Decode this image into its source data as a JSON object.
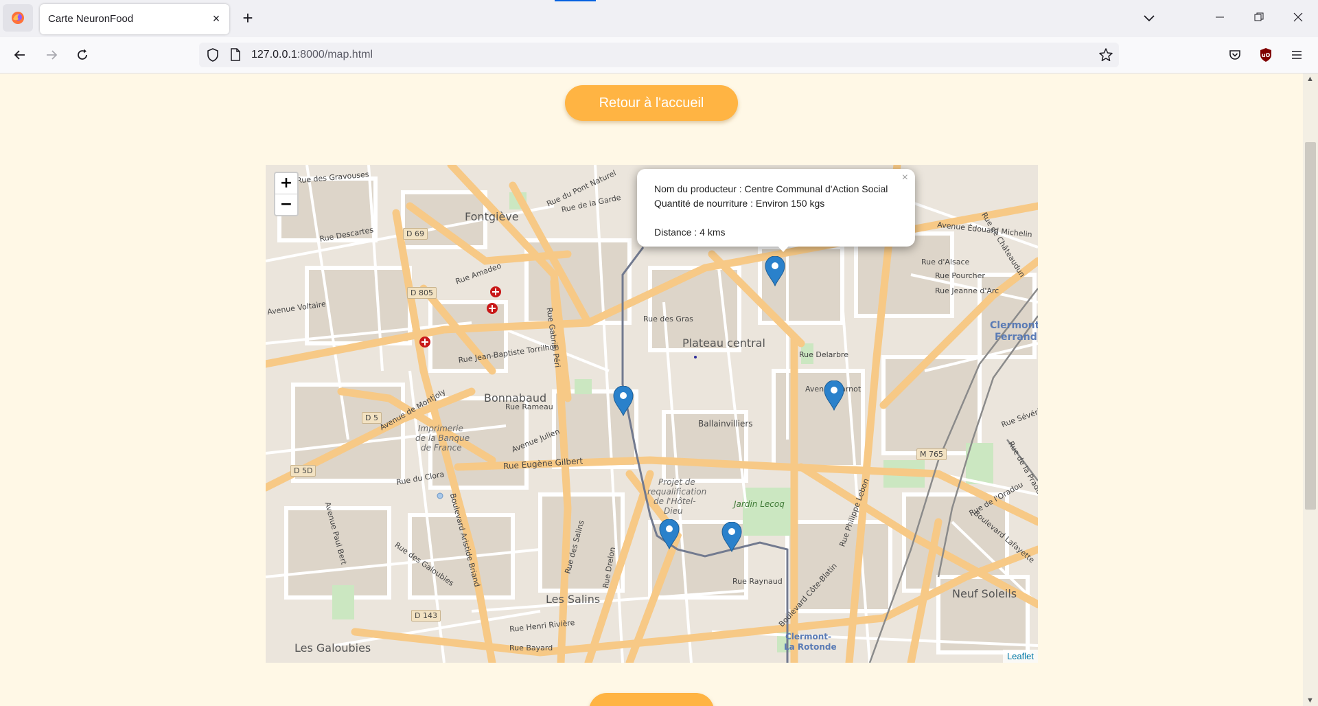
{
  "browser": {
    "tab_title": "Carte NeuronFood",
    "tab_close": "×",
    "new_tab": "+",
    "url_host": "127.0.0.1",
    "url_rest": ":8000/map.html"
  },
  "page": {
    "home_button": "Retour à l'accueil",
    "bottom_button": ""
  },
  "map": {
    "zoom_in": "+",
    "zoom_out": "−",
    "attribution": "Leaflet",
    "popup": {
      "close": "×",
      "producer": "Nom du producteur : Centre Communal d'Action Social",
      "quantity": "Quantité de nourriture : Environ 150 kgs",
      "distance": "Distance : 4 kms"
    },
    "labels": {
      "fontgieve": "Fontgiève",
      "plateau": "Plateau central",
      "bonnabaud": "Bonnabaud",
      "ballainvilliers": "Ballainvilliers",
      "les_salins": "Les Salins",
      "les_galoubies": "Les Galoubies",
      "neuf_soleils": "Neuf Soleils",
      "clermont_ferrand_1": "Clermont-",
      "clermont_ferrand_2": "Ferrand",
      "clermont_rotonde_1": "Clermont-",
      "clermont_rotonde_2": "La Rotonde",
      "imprimerie": "Imprimerie",
      "imprimerie_2": "de la Banque",
      "imprimerie_3": "de France",
      "projet_1": "Projet de",
      "projet_2": "requalification",
      "projet_3": "de l'Hôtel-",
      "projet_4": "Dieu",
      "jardin": "Jardin Lecoq",
      "avenue_voltaire": "Avenue Voltaire",
      "rue_eugene_gilbert": "Rue Eugène Gilbert",
      "avenue_julien": "Avenue Julien",
      "avenue_carnot": "Avenue Carnot",
      "avenue_edouard_michelin": "Avenue Édouard Michelin",
      "boulevard_lafayette": "Boulevard Lafayette",
      "boulevard_cote_blatin": "Boulevard Côte-Blatin",
      "boulevard_aristide_briand": "Boulevard Aristide Briand",
      "rue_gabriel_peri": "Rue Gabriel Péri",
      "rue_des_gras": "Rue des Gras",
      "rue_delarbre": "Rue Delarbre",
      "rue_jeanne_darc": "Rue Jeanne d'Arc",
      "rue_dalsace": "Rue d'Alsace",
      "rue_raynaud": "Rue Raynaud",
      "rue_de_lоradou": "Rue de l'Oradou",
      "rue_amadeo": "Rue Amadeo",
      "rue_rameau": "Rue Rameau",
      "rue_des_salins": "Rue des Salins",
      "rue_drelon": "Rue Drelon",
      "avenue_de_montjoly": "Avenue de Montjoly",
      "rue_de_la_garde": "Rue de la Garde",
      "rue_du_pont_naturel": "Rue du Pont Naturel",
      "rue_des_gravouses": "Rue des Gravouses",
      "rue_descartes": "Rue Descartes",
      "rue_henri_riviere": "Rue Henri Rivière",
      "rue_bayard": "Rue Bayard",
      "rue_du_clora": "Rue du Clora",
      "avenue_paul_bert": "Avenue Paul Bert",
      "rue_des_galoubies": "Rue des Galoubies",
      "rue_pourcher": "Rue Pourcher",
      "rue_de_la_pradelle": "Rue de la Pradelle",
      "rue_severine": "Rue Sévérine",
      "rue_de_chateaudun": "Rue de Châteaudun",
      "rue_philippe_lebon": "Rue Philippe Lebon",
      "rue_jean_baptiste_torrilhon": "Rue Jean-Baptiste Torrilhon",
      "d69": "D 69",
      "d805": "D 805",
      "d5": "D 5",
      "d5d": "D 5D",
      "d143": "D 143",
      "m765": "M 765"
    }
  },
  "colors": {
    "accent_orange": "#ffb443",
    "page_background": "#fff8e6",
    "marker_blue": "#2a81cb",
    "link_blue": "#0078a8"
  }
}
